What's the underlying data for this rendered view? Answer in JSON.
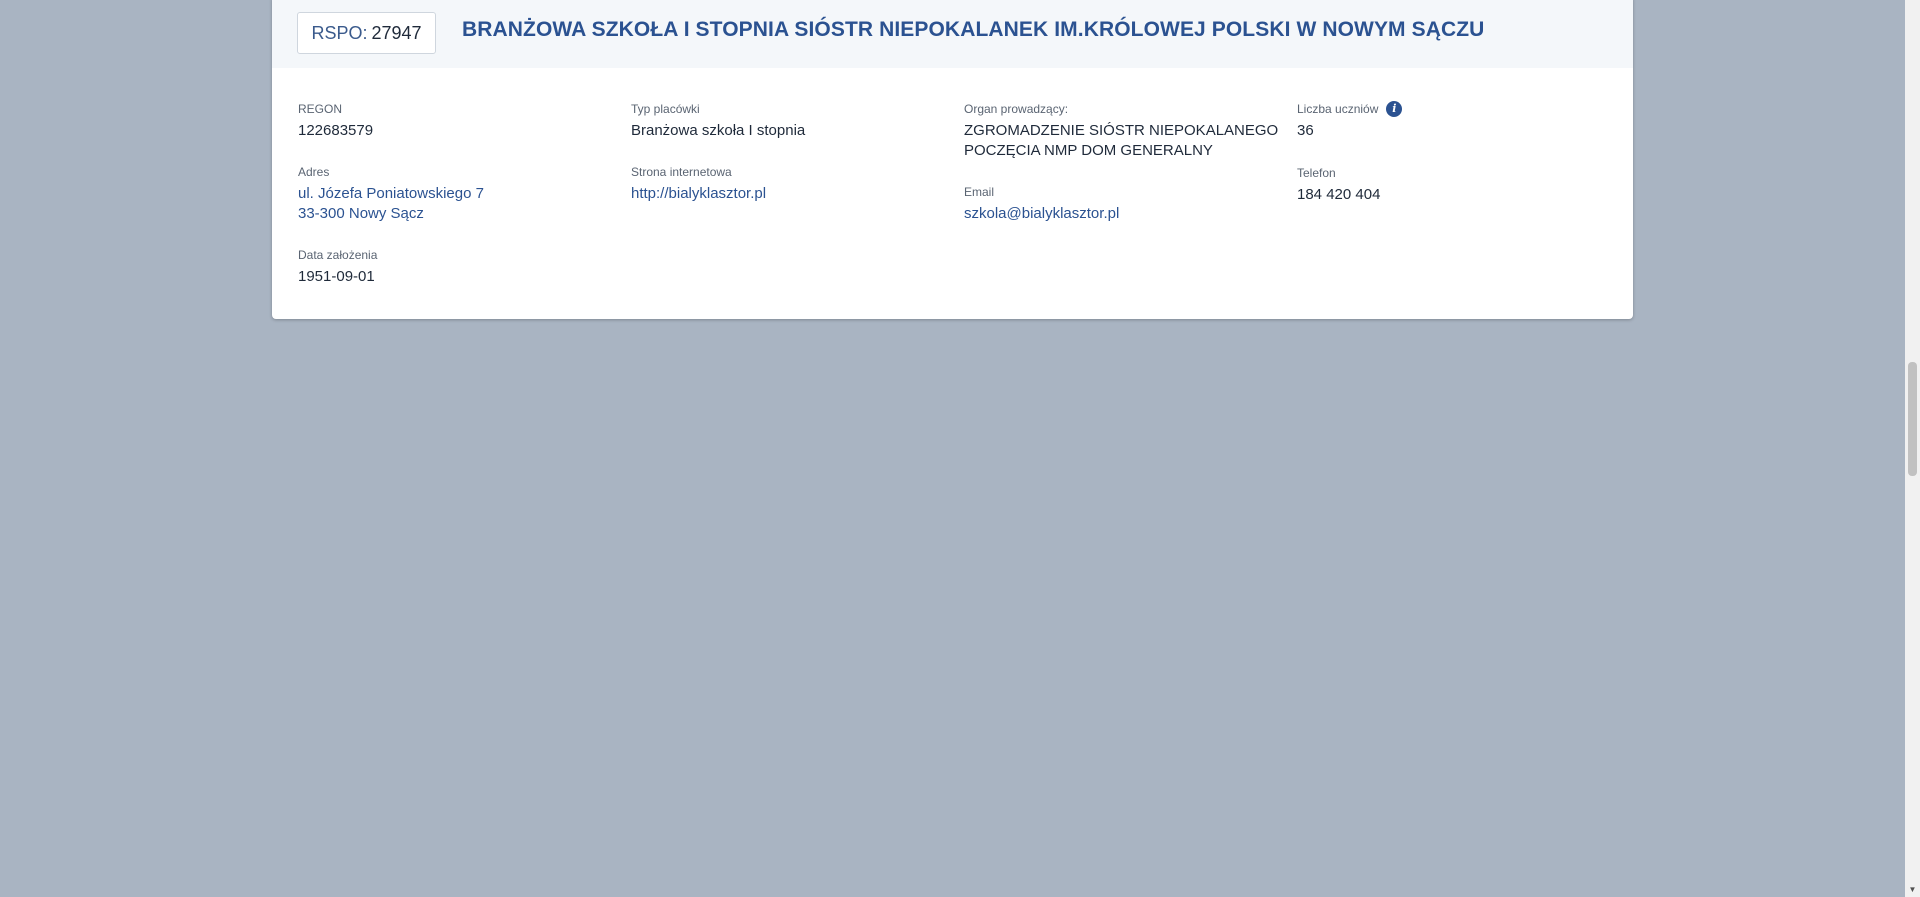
{
  "card": {
    "rspo_label": "RSPO:",
    "rspo_value": "27947",
    "title": "BRANŻOWA SZKOŁA I STOPNIA SIÓSTR NIEPOKALANEK IM.KRÓLOWEJ POLSKI W NOWYM SĄCZU"
  },
  "fields": {
    "regon": {
      "label": "REGON",
      "value": "122683579"
    },
    "typ": {
      "label": "Typ placówki",
      "value": "Branżowa szkoła I stopnia"
    },
    "organ": {
      "label": "Organ prowadzący:",
      "value_line1": "ZGROMADZENIE SIÓSTR NIEPOKALANEGO",
      "value_line2": "POCZĘCIA NMP DOM GENERALNY"
    },
    "uczniowie": {
      "label": "Liczba uczniów",
      "value": "36",
      "icon": "info-icon"
    },
    "adres": {
      "label": "Adres",
      "line1": "ul. Józefa Poniatowskiego 7",
      "line2": "33-300 Nowy Sącz"
    },
    "strona": {
      "label": "Strona internetowa",
      "value": "http://bialyklasztor.pl"
    },
    "email": {
      "label": "Email",
      "value": "szkola@bialyklasztor.pl"
    },
    "telefon": {
      "label": "Telefon",
      "value": "184 420 404"
    },
    "data_zalozenia": {
      "label": "Data założenia",
      "value": "1951-09-01"
    }
  },
  "colors": {
    "background": "#a9b4c2",
    "accent": "#2b5291",
    "header_bg": "#f4f7fa"
  },
  "scrollbar": {
    "arrow_down": "▼"
  }
}
